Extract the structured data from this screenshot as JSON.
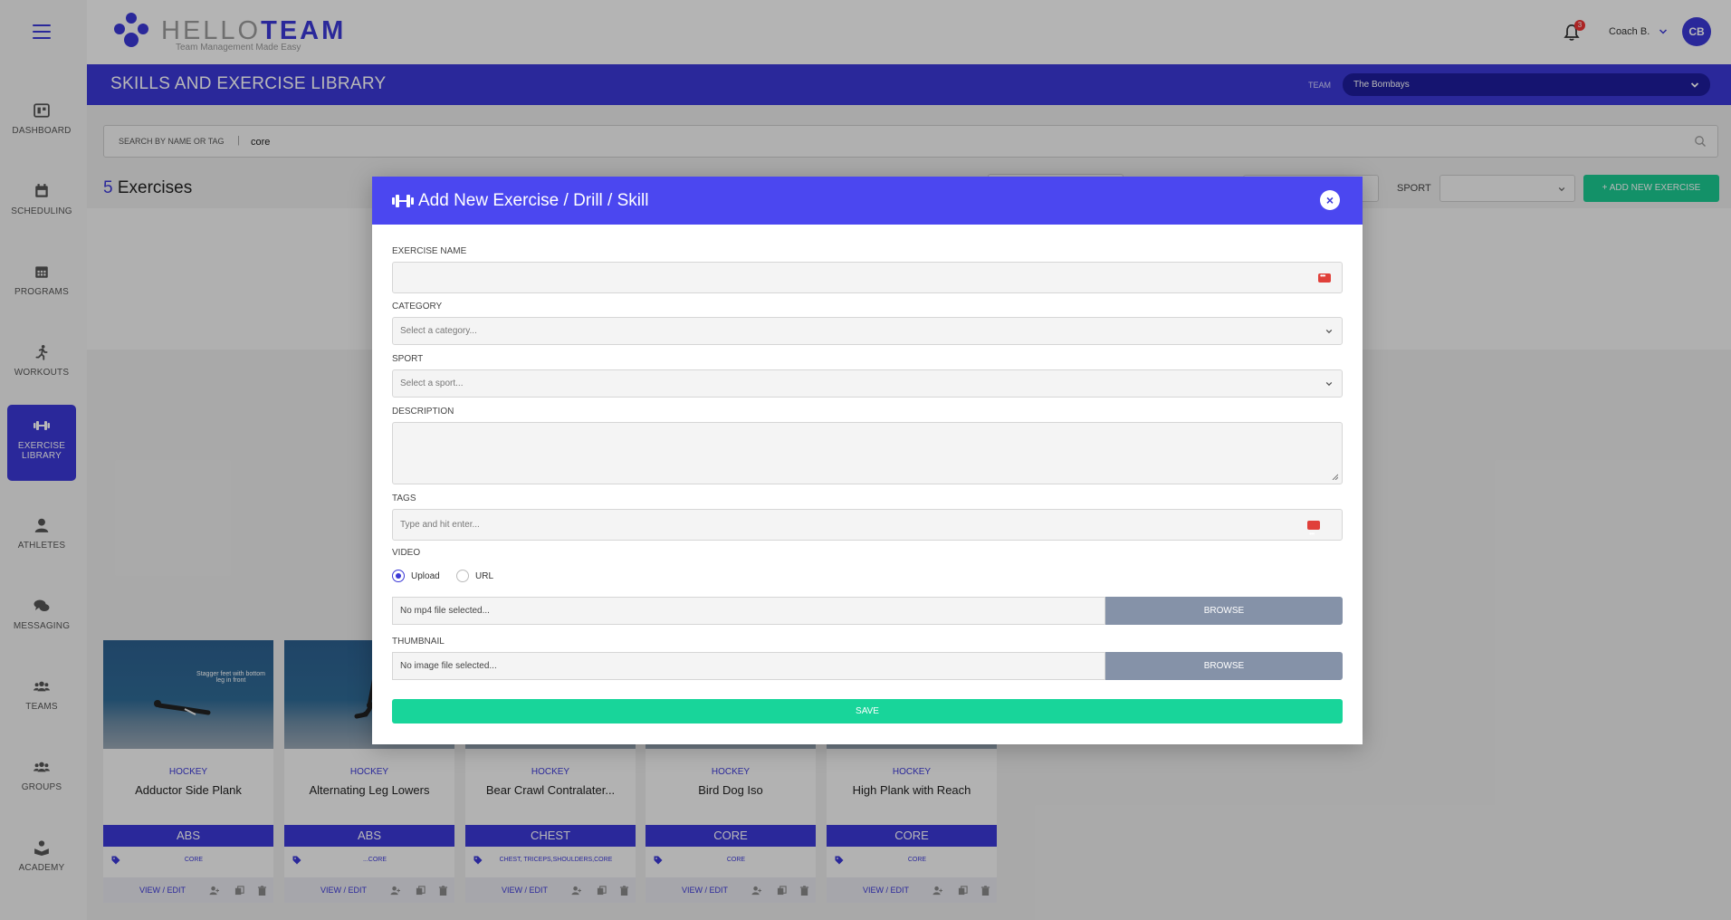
{
  "sidebar": {
    "items": [
      {
        "label": "DASHBOARD",
        "icon": "dashboard-icon"
      },
      {
        "label": "SCHEDULING",
        "icon": "calendar-icon"
      },
      {
        "label": "PROGRAMS",
        "icon": "calendar-grid-icon"
      },
      {
        "label": "WORKOUTS",
        "icon": "running-icon"
      },
      {
        "label": "EXERCISE LIBRARY",
        "icon": "dumbbell-icon"
      },
      {
        "label": "ATHLETES",
        "icon": "user-icon"
      },
      {
        "label": "MESSAGING",
        "icon": "chat-icon"
      },
      {
        "label": "TEAMS",
        "icon": "users-icon"
      },
      {
        "label": "GROUPS",
        "icon": "group-icon"
      },
      {
        "label": "ACADEMY",
        "icon": "academy-icon"
      }
    ]
  },
  "header": {
    "logo_light": "HELLO",
    "logo_bold": "TEAM",
    "tagline": "Team Management Made Easy",
    "notification_count": "3",
    "user_name": "Coach B.",
    "avatar_initials": "CB"
  },
  "titlebar": {
    "title": "SKILLS AND EXERCISE LIBRARY",
    "team_label": "TEAM",
    "team_value": "The Bombays"
  },
  "search": {
    "label": "SEARCH BY NAME OR TAG",
    "separator": "|",
    "value": "core"
  },
  "results": {
    "count": "5",
    "count_label": "Exercises"
  },
  "filters": {
    "sport_label": "SPORT",
    "add_button": "+ ADD NEW EXERCISE"
  },
  "cards": [
    {
      "sport": "HOCKEY",
      "name": "Adductor Side Plank",
      "category": "ABS",
      "tags": "CORE",
      "action": "VIEW / EDIT",
      "caption": "Stagger feet with bottom leg in front"
    },
    {
      "sport": "HOCKEY",
      "name": "Alternating Leg Lowers",
      "category": "ABS",
      "tags": "...CORE",
      "action": "VIEW / EDIT",
      "caption": ""
    },
    {
      "sport": "HOCKEY",
      "name": "Bear Crawl Contralater...",
      "category": "CHEST",
      "tags": "CHEST, TRICEPS,SHOULDERS,CORE",
      "action": "VIEW / EDIT",
      "caption": ""
    },
    {
      "sport": "HOCKEY",
      "name": "Bird Dog Iso",
      "category": "CORE",
      "tags": "CORE",
      "action": "VIEW / EDIT",
      "caption": ""
    },
    {
      "sport": "HOCKEY",
      "name": "High Plank with Reach",
      "category": "CORE",
      "tags": "CORE",
      "action": "VIEW / EDIT",
      "caption": ""
    }
  ],
  "modal": {
    "title": "Add New Exercise / Drill / Skill",
    "close": "×",
    "exercise_name_label": "EXERCISE NAME",
    "category_label": "CATEGORY",
    "category_placeholder": "Select a category...",
    "sport_label": "SPORT",
    "sport_placeholder": "Select a sport...",
    "description_label": "DESCRIPTION",
    "tags_label": "TAGS",
    "tags_placeholder": "Type and hit enter...",
    "video_label": "VIDEO",
    "video_upload": "Upload",
    "video_url": "URL",
    "video_file": "No mp4 file selected...",
    "browse": "BROWSE",
    "thumbnail_label": "THUMBNAIL",
    "thumbnail_file": "No image file selected...",
    "save": "SAVE"
  },
  "colors": {
    "brand": "#3b38d6",
    "modal_header": "#4b47f0",
    "save": "#18d59a",
    "add": "#1bc991",
    "browse": "#8592a8"
  }
}
